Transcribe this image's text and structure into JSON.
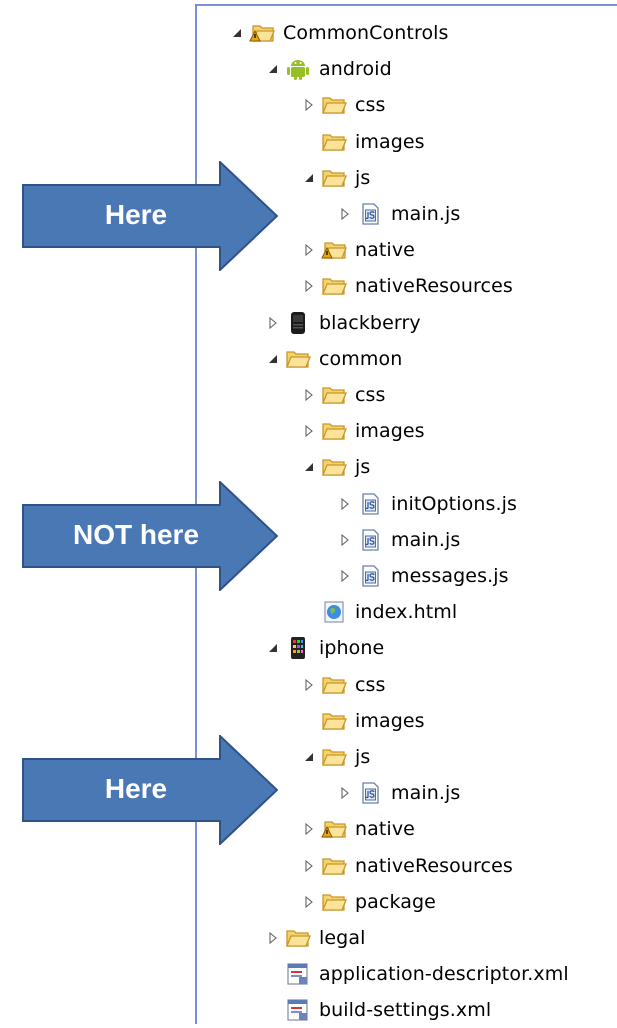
{
  "tree": [
    {
      "label": "CommonControls",
      "depth": 0,
      "icon": "warning-folder-icon",
      "twisty": "expanded"
    },
    {
      "label": "android",
      "depth": 1,
      "icon": "android-icon",
      "twisty": "expanded"
    },
    {
      "label": "css",
      "depth": 2,
      "icon": "folder-icon",
      "twisty": "collapsed"
    },
    {
      "label": "images",
      "depth": 2,
      "icon": "folder-icon",
      "twisty": "none"
    },
    {
      "label": "js",
      "depth": 2,
      "icon": "folder-icon",
      "twisty": "expanded"
    },
    {
      "label": "main.js",
      "depth": 3,
      "icon": "js-file-icon",
      "twisty": "collapsed"
    },
    {
      "label": "native",
      "depth": 2,
      "icon": "warning-folder-icon",
      "twisty": "collapsed"
    },
    {
      "label": "nativeResources",
      "depth": 2,
      "icon": "folder-icon",
      "twisty": "collapsed"
    },
    {
      "label": "blackberry",
      "depth": 1,
      "icon": "blackberry-icon",
      "twisty": "collapsed"
    },
    {
      "label": "common",
      "depth": 1,
      "icon": "folder-icon",
      "twisty": "expanded"
    },
    {
      "label": "css",
      "depth": 2,
      "icon": "folder-icon",
      "twisty": "collapsed"
    },
    {
      "label": "images",
      "depth": 2,
      "icon": "folder-icon",
      "twisty": "collapsed"
    },
    {
      "label": "js",
      "depth": 2,
      "icon": "folder-icon",
      "twisty": "expanded"
    },
    {
      "label": "initOptions.js",
      "depth": 3,
      "icon": "js-file-icon",
      "twisty": "collapsed"
    },
    {
      "label": "main.js",
      "depth": 3,
      "icon": "js-file-icon",
      "twisty": "collapsed"
    },
    {
      "label": "messages.js",
      "depth": 3,
      "icon": "js-file-icon",
      "twisty": "collapsed"
    },
    {
      "label": "index.html",
      "depth": 2,
      "icon": "html-file-icon",
      "twisty": "none"
    },
    {
      "label": "iphone",
      "depth": 1,
      "icon": "iphone-icon",
      "twisty": "expanded"
    },
    {
      "label": "css",
      "depth": 2,
      "icon": "folder-icon",
      "twisty": "collapsed"
    },
    {
      "label": "images",
      "depth": 2,
      "icon": "folder-icon",
      "twisty": "none"
    },
    {
      "label": "js",
      "depth": 2,
      "icon": "folder-icon",
      "twisty": "expanded"
    },
    {
      "label": "main.js",
      "depth": 3,
      "icon": "js-file-icon",
      "twisty": "collapsed"
    },
    {
      "label": "native",
      "depth": 2,
      "icon": "warning-folder-icon",
      "twisty": "collapsed"
    },
    {
      "label": "nativeResources",
      "depth": 2,
      "icon": "folder-icon",
      "twisty": "collapsed"
    },
    {
      "label": "package",
      "depth": 2,
      "icon": "folder-icon",
      "twisty": "collapsed"
    },
    {
      "label": "legal",
      "depth": 1,
      "icon": "folder-icon",
      "twisty": "collapsed"
    },
    {
      "label": "application-descriptor.xml",
      "depth": 1,
      "icon": "xml-file-icon",
      "twisty": "none"
    },
    {
      "label": "build-settings.xml",
      "depth": 1,
      "icon": "xml-file-icon",
      "twisty": "none"
    }
  ],
  "callouts": [
    {
      "text": "Here"
    },
    {
      "text": "NOT here"
    },
    {
      "text": "Here"
    }
  ],
  "colors": {
    "panel_border": "#7b8fd2",
    "callout_fill": "#4a78b5",
    "callout_stroke": "#2f5288",
    "folder": "#f5d36b",
    "folder_edge": "#c8962a",
    "android": "#97c024",
    "warning": "#e8a516"
  }
}
